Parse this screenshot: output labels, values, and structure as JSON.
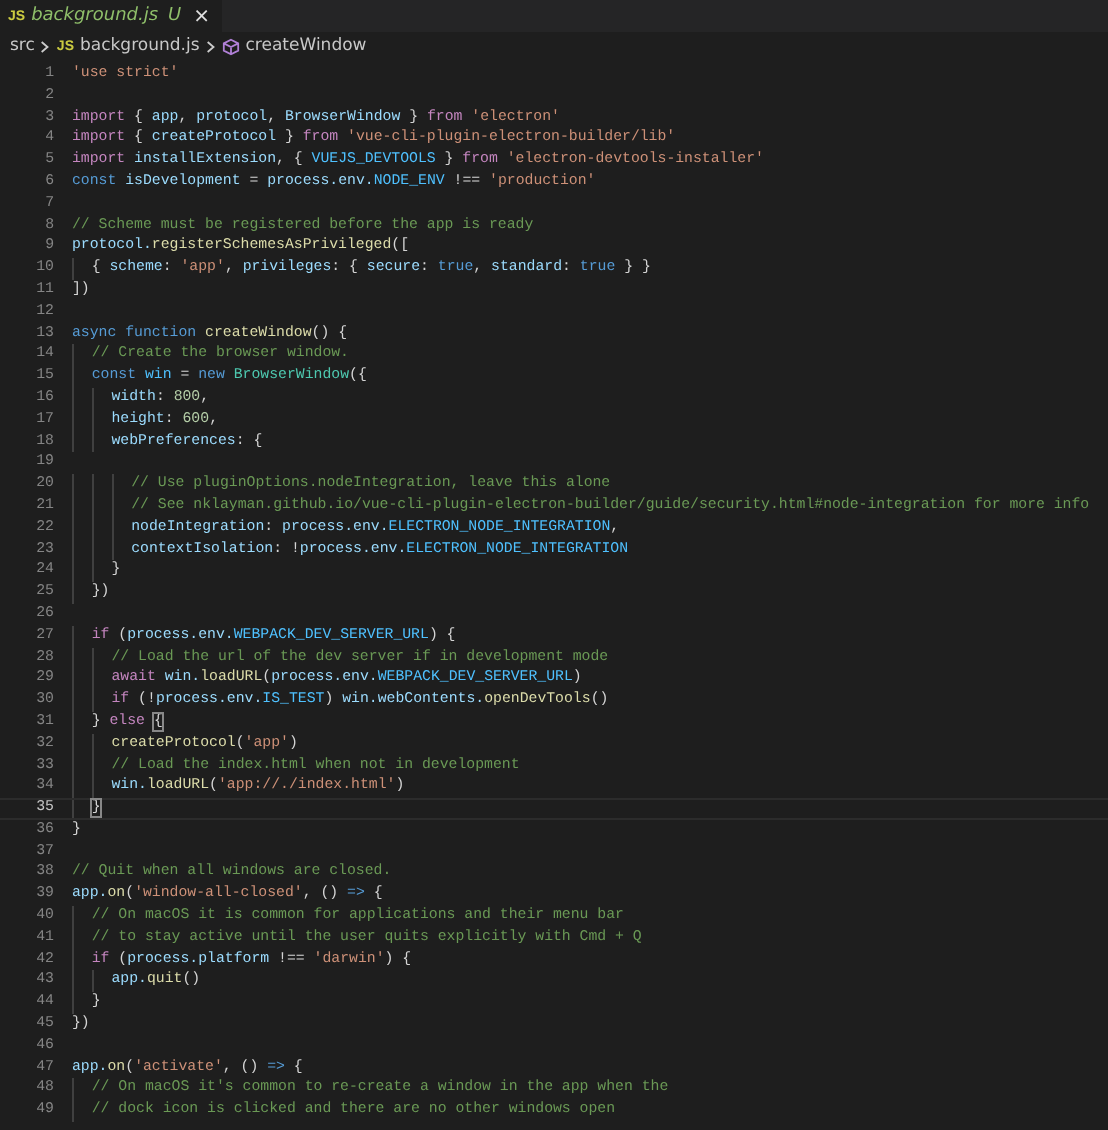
{
  "tab": {
    "icon": "JS",
    "file": "background.js",
    "status": "U",
    "close": "×",
    "selected": true
  },
  "breadcrumbs": [
    {
      "kind": "folder",
      "label": "src"
    },
    {
      "kind": "file",
      "icon": "JS",
      "label": "background.js"
    },
    {
      "kind": "method",
      "label": "createWindow"
    }
  ],
  "lines": [
    {
      "number": "1",
      "current": false,
      "tokens": [
        {
          "kind": "str",
          "text": "'use strict'"
        }
      ]
    },
    {
      "number": "2",
      "current": false
    },
    {
      "number": "3",
      "current": false,
      "tokens": [
        {
          "kind": "kw",
          "text": "import "
        },
        {
          "kind": "p",
          "text": "{ "
        },
        {
          "kind": "var",
          "text": "app"
        },
        {
          "kind": "p",
          "text": ", "
        },
        {
          "kind": "var",
          "text": "protocol"
        },
        {
          "kind": "p",
          "text": ", "
        },
        {
          "kind": "var",
          "text": "BrowserWindow"
        },
        {
          "kind": "p",
          "text": " } "
        },
        {
          "kind": "kw",
          "text": "from "
        },
        {
          "kind": "str",
          "text": "'electron'"
        }
      ]
    },
    {
      "number": "4",
      "current": false,
      "tokens": [
        {
          "kind": "kw",
          "text": "import "
        },
        {
          "kind": "p",
          "text": "{ "
        },
        {
          "kind": "var",
          "text": "createProtocol"
        },
        {
          "kind": "p",
          "text": " } "
        },
        {
          "kind": "kw",
          "text": "from "
        },
        {
          "kind": "str",
          "text": "'vue-cli-plugin-electron-builder/lib'"
        }
      ]
    },
    {
      "number": "5",
      "current": false,
      "tokens": [
        {
          "kind": "kw",
          "text": "import "
        },
        {
          "kind": "var",
          "text": "installExtension"
        },
        {
          "kind": "p",
          "text": ", { "
        },
        {
          "kind": "const",
          "text": "VUEJS_DEVTOOLS"
        },
        {
          "kind": "p",
          "text": " } "
        },
        {
          "kind": "kw",
          "text": "from "
        },
        {
          "kind": "str",
          "text": "'electron-devtools-installer'"
        }
      ]
    },
    {
      "number": "6",
      "current": false,
      "tokens": [
        {
          "kind": "st",
          "text": "const "
        },
        {
          "kind": "var",
          "text": "isDevelopment"
        },
        {
          "kind": "p",
          "text": " = "
        },
        {
          "kind": "var",
          "text": "process."
        },
        {
          "kind": "var",
          "text": "env."
        },
        {
          "kind": "const",
          "text": "NODE_ENV"
        },
        {
          "kind": "p",
          "text": " !== "
        },
        {
          "kind": "str",
          "text": "'production'"
        }
      ]
    },
    {
      "number": "7",
      "current": false
    },
    {
      "number": "8",
      "current": false,
      "tokens": [
        {
          "kind": "com",
          "text": "// Scheme must be registered before the app is ready"
        }
      ]
    },
    {
      "number": "9",
      "current": false,
      "tokens": [
        {
          "kind": "var",
          "text": "protocol."
        },
        {
          "kind": "fn",
          "text": "registerSchemesAsPrivileged"
        },
        {
          "kind": "p",
          "text": "(["
        }
      ]
    },
    {
      "number": "10",
      "current": false,
      "tokens": [
        {
          "kind": "p",
          "text": "  { "
        },
        {
          "kind": "var",
          "text": "scheme"
        },
        {
          "kind": "p",
          "text": ": "
        },
        {
          "kind": "str",
          "text": "'app'"
        },
        {
          "kind": "p",
          "text": ", "
        },
        {
          "kind": "var",
          "text": "privileges"
        },
        {
          "kind": "p",
          "text": ": { "
        },
        {
          "kind": "var",
          "text": "secure"
        },
        {
          "kind": "p",
          "text": ": "
        },
        {
          "kind": "st",
          "text": "true"
        },
        {
          "kind": "p",
          "text": ", "
        },
        {
          "kind": "var",
          "text": "standard"
        },
        {
          "kind": "p",
          "text": ": "
        },
        {
          "kind": "st",
          "text": "true"
        },
        {
          "kind": "p",
          "text": " } }"
        }
      ]
    },
    {
      "number": "11",
      "current": false,
      "tokens": [
        {
          "kind": "p",
          "text": "])"
        }
      ]
    },
    {
      "number": "12",
      "current": false
    },
    {
      "number": "13",
      "current": false,
      "tokens": [
        {
          "kind": "st",
          "text": "async "
        },
        {
          "kind": "st",
          "text": "function "
        },
        {
          "kind": "fn",
          "text": "createWindow"
        },
        {
          "kind": "p",
          "text": "() {"
        }
      ]
    },
    {
      "number": "14",
      "current": false,
      "tokens": [
        {
          "kind": "com",
          "text": "  // Create the browser window."
        }
      ]
    },
    {
      "number": "15",
      "current": false,
      "tokens": [
        {
          "kind": "st",
          "text": "  const "
        },
        {
          "kind": "const",
          "text": "win"
        },
        {
          "kind": "p",
          "text": " = "
        },
        {
          "kind": "st",
          "text": "new "
        },
        {
          "kind": "cls",
          "text": "BrowserWindow"
        },
        {
          "kind": "p",
          "text": "({"
        }
      ]
    },
    {
      "number": "16",
      "current": false,
      "tokens": [
        {
          "kind": "var",
          "text": "    width"
        },
        {
          "kind": "p",
          "text": ": "
        },
        {
          "kind": "num",
          "text": "800"
        },
        {
          "kind": "p",
          "text": ","
        }
      ]
    },
    {
      "number": "17",
      "current": false,
      "tokens": [
        {
          "kind": "var",
          "text": "    height"
        },
        {
          "kind": "p",
          "text": ": "
        },
        {
          "kind": "num",
          "text": "600"
        },
        {
          "kind": "p",
          "text": ","
        }
      ]
    },
    {
      "number": "18",
      "current": false,
      "tokens": [
        {
          "kind": "var",
          "text": "    webPreferences"
        },
        {
          "kind": "p",
          "text": ": {"
        }
      ]
    },
    {
      "number": "19",
      "current": false
    },
    {
      "number": "20",
      "current": false,
      "tokens": [
        {
          "kind": "com",
          "text": "      // Use pluginOptions.nodeIntegration, leave this alone"
        }
      ]
    },
    {
      "number": "21",
      "current": false,
      "tokens": [
        {
          "kind": "com",
          "text": "      // See nklayman.github.io/vue-cli-plugin-electron-builder/guide/security.html#node-integration for more info"
        }
      ]
    },
    {
      "number": "22",
      "current": false,
      "tokens": [
        {
          "kind": "var",
          "text": "      nodeIntegration"
        },
        {
          "kind": "p",
          "text": ": "
        },
        {
          "kind": "var",
          "text": "process."
        },
        {
          "kind": "var",
          "text": "env."
        },
        {
          "kind": "const",
          "text": "ELECTRON_NODE_INTEGRATION"
        },
        {
          "kind": "p",
          "text": ","
        }
      ]
    },
    {
      "number": "23",
      "current": false,
      "tokens": [
        {
          "kind": "var",
          "text": "      contextIsolation"
        },
        {
          "kind": "p",
          "text": ": !"
        },
        {
          "kind": "var",
          "text": "process."
        },
        {
          "kind": "var",
          "text": "env."
        },
        {
          "kind": "const",
          "text": "ELECTRON_NODE_INTEGRATION"
        }
      ]
    },
    {
      "number": "24",
      "current": false,
      "tokens": [
        {
          "kind": "p",
          "text": "    }"
        }
      ]
    },
    {
      "number": "25",
      "current": false,
      "tokens": [
        {
          "kind": "p",
          "text": "  })"
        }
      ]
    },
    {
      "number": "26",
      "current": false
    },
    {
      "number": "27",
      "current": false,
      "tokens": [
        {
          "kind": "kw",
          "text": "  if"
        },
        {
          "kind": "p",
          "text": " ("
        },
        {
          "kind": "var",
          "text": "process."
        },
        {
          "kind": "var",
          "text": "env."
        },
        {
          "kind": "const",
          "text": "WEBPACK_DEV_SERVER_URL"
        },
        {
          "kind": "p",
          "text": ") {"
        }
      ]
    },
    {
      "number": "28",
      "current": false,
      "tokens": [
        {
          "kind": "com",
          "text": "    // Load the url of the dev server if in development mode"
        }
      ]
    },
    {
      "number": "29",
      "current": false,
      "tokens": [
        {
          "kind": "kw",
          "text": "    await "
        },
        {
          "kind": "var",
          "text": "win."
        },
        {
          "kind": "fn",
          "text": "loadURL"
        },
        {
          "kind": "p",
          "text": "("
        },
        {
          "kind": "var",
          "text": "process."
        },
        {
          "kind": "var",
          "text": "env."
        },
        {
          "kind": "const",
          "text": "WEBPACK_DEV_SERVER_URL"
        },
        {
          "kind": "p",
          "text": ")"
        }
      ]
    },
    {
      "number": "30",
      "current": false,
      "tokens": [
        {
          "kind": "kw",
          "text": "    if"
        },
        {
          "kind": "p",
          "text": " (!"
        },
        {
          "kind": "var",
          "text": "process."
        },
        {
          "kind": "var",
          "text": "env."
        },
        {
          "kind": "const",
          "text": "IS_TEST"
        },
        {
          "kind": "p",
          "text": ") "
        },
        {
          "kind": "var",
          "text": "win."
        },
        {
          "kind": "var",
          "text": "webContents."
        },
        {
          "kind": "fn",
          "text": "openDevTools"
        },
        {
          "kind": "p",
          "text": "()"
        }
      ]
    },
    {
      "number": "31",
      "current": false,
      "tokens": [
        {
          "kind": "p",
          "text": "  } "
        },
        {
          "kind": "kw",
          "text": "else "
        },
        {
          "kind": "match",
          "text": "{"
        }
      ]
    },
    {
      "number": "32",
      "current": false,
      "tokens": [
        {
          "kind": "fn",
          "text": "    createProtocol"
        },
        {
          "kind": "p",
          "text": "("
        },
        {
          "kind": "str",
          "text": "'app'"
        },
        {
          "kind": "p",
          "text": ")"
        }
      ]
    },
    {
      "number": "33",
      "current": false,
      "tokens": [
        {
          "kind": "com",
          "text": "    // Load the index.html when not in development"
        }
      ]
    },
    {
      "number": "34",
      "current": false,
      "tokens": [
        {
          "kind": "var",
          "text": "    win."
        },
        {
          "kind": "fn",
          "text": "loadURL"
        },
        {
          "kind": "p",
          "text": "("
        },
        {
          "kind": "str",
          "text": "'app://./index.html'"
        },
        {
          "kind": "p",
          "text": ")"
        }
      ]
    },
    {
      "number": "35",
      "current": true,
      "tokens": [
        {
          "kind": "match",
          "text": "  }"
        }
      ]
    },
    {
      "number": "36",
      "current": false,
      "tokens": [
        {
          "kind": "p",
          "text": "}"
        }
      ]
    },
    {
      "number": "37",
      "current": false
    },
    {
      "number": "38",
      "current": false,
      "tokens": [
        {
          "kind": "com",
          "text": "// Quit when all windows are closed."
        }
      ]
    },
    {
      "number": "39",
      "current": false,
      "tokens": [
        {
          "kind": "var",
          "text": "app."
        },
        {
          "kind": "fn",
          "text": "on"
        },
        {
          "kind": "p",
          "text": "("
        },
        {
          "kind": "str",
          "text": "'window-all-closed'"
        },
        {
          "kind": "p",
          "text": ", () "
        },
        {
          "kind": "st",
          "text": "=> "
        },
        {
          "kind": "p",
          "text": "{"
        }
      ]
    },
    {
      "number": "40",
      "current": false,
      "tokens": [
        {
          "kind": "com",
          "text": "  // On macOS it is common for applications and their menu bar"
        }
      ]
    },
    {
      "number": "41",
      "current": false,
      "tokens": [
        {
          "kind": "com",
          "text": "  // to stay active until the user quits explicitly with Cmd + Q"
        }
      ]
    },
    {
      "number": "42",
      "current": false,
      "tokens": [
        {
          "kind": "kw",
          "text": "  if"
        },
        {
          "kind": "p",
          "text": " ("
        },
        {
          "kind": "var",
          "text": "process."
        },
        {
          "kind": "var",
          "text": "platform"
        },
        {
          "kind": "p",
          "text": " !== "
        },
        {
          "kind": "str",
          "text": "'darwin'"
        },
        {
          "kind": "p",
          "text": ") {"
        }
      ]
    },
    {
      "number": "43",
      "current": false,
      "tokens": [
        {
          "kind": "var",
          "text": "    app."
        },
        {
          "kind": "fn",
          "text": "quit"
        },
        {
          "kind": "p",
          "text": "()"
        }
      ]
    },
    {
      "number": "44",
      "current": false,
      "tokens": [
        {
          "kind": "p",
          "text": "  }"
        }
      ]
    },
    {
      "number": "45",
      "current": false,
      "tokens": [
        {
          "kind": "p",
          "text": "})"
        }
      ]
    },
    {
      "number": "46",
      "current": false
    },
    {
      "number": "47",
      "current": false,
      "tokens": [
        {
          "kind": "var",
          "text": "app."
        },
        {
          "kind": "fn",
          "text": "on"
        },
        {
          "kind": "p",
          "text": "("
        },
        {
          "kind": "str",
          "text": "'activate'"
        },
        {
          "kind": "p",
          "text": ", () "
        },
        {
          "kind": "st",
          "text": "=> "
        },
        {
          "kind": "p",
          "text": "{"
        }
      ]
    },
    {
      "number": "48",
      "current": false,
      "tokens": [
        {
          "kind": "com",
          "text": "  // On macOS it's common to re-create a window in the app when the"
        }
      ]
    },
    {
      "number": "49",
      "current": false,
      "tokens": [
        {
          "kind": "com",
          "text": "  // dock icon is clicked and there are no other windows open"
        }
      ]
    }
  ]
}
